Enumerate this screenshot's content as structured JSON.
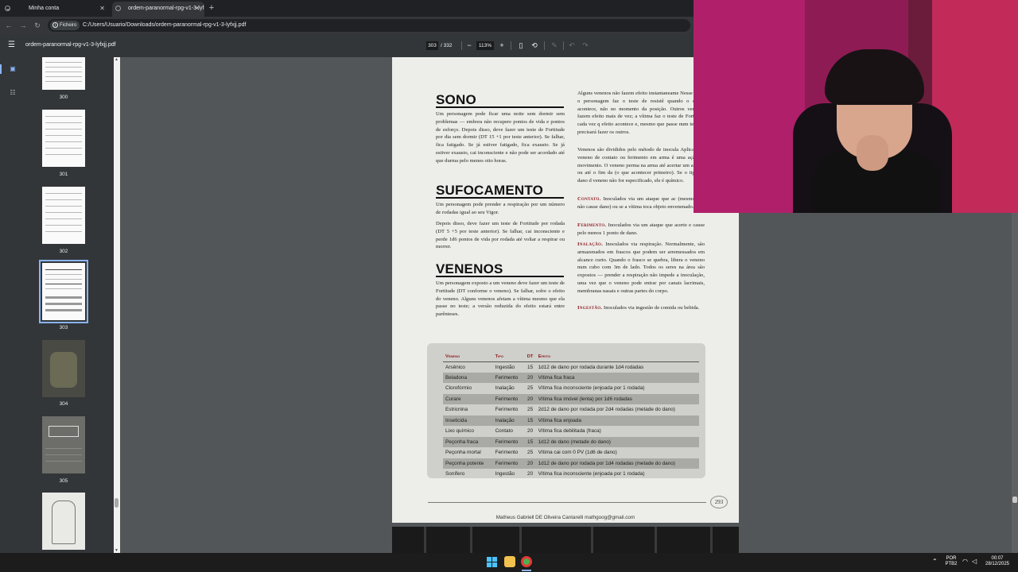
{
  "browser": {
    "tabs": [
      {
        "title": "Minha conta",
        "active": false
      },
      {
        "title": "ordem-paranormal-rpg-v1-3-lyf",
        "active": true
      }
    ],
    "address": {
      "chip": "Ficheiro",
      "url": "C:/Users/Usuario/Downloads/ordem-paranormal-rpg-v1-3-lyfxjj.pdf"
    }
  },
  "pdf_toolbar": {
    "doc_name": "ordem-paranormal-rpg-v1-3-lyfxjj.pdf",
    "current_page": "303",
    "page_total": "/ 332",
    "zoom": "113%"
  },
  "sidebar": {
    "thumbnails": [
      {
        "page": "300"
      },
      {
        "page": "301"
      },
      {
        "page": "302"
      },
      {
        "page": "303",
        "selected": true
      },
      {
        "page": "304"
      },
      {
        "page": "305"
      },
      {
        "page": ""
      }
    ]
  },
  "page": {
    "sono": {
      "heading": "SONO",
      "text": "Um personagem pode ficar uma noite sem dormir sem problemas — embora não recupere pontos de vida e pontos de esforço. Depois disso, deve fazer um teste de Fortitude por dia sem dormir (DT 15 +1 por teste anterior). Se falhar, fica fatigado. Se já estiver fatigado, fica exausto. Se já estiver exausto, cai inconsciente e não pode ser acordado até que durma pelo menos oito horas."
    },
    "sufocamento": {
      "heading": "SUFOCAMENTO",
      "text1": "Um personagem pode prender a respiração por um número de rodadas igual ao seu Vigor.",
      "text2": "Depois disso, deve fazer um teste de Fortitude por rodada (DT 5 +5 por teste anterior). Se falhar, cai inconsciente e perde 1d6 pontos de vida por rodada até voltar a respirar ou morrer."
    },
    "venenos": {
      "heading": "VENENOS",
      "text": "Um personagem exposto a um veneno deve fazer um teste de Fortitude (DT conforme o veneno). Se falhar, sofre o efeito do veneno. Alguns venenos afetam a vítima mesmo que ela passe no teste; a versão reduzida do efeito estará entre parênteses."
    },
    "right": {
      "p1": "Alguns venenos não fazem efeito instantaneame Nesse caso, o personagem faz o teste de resistê quando o efeito acontece, não no momento da posição. Outros venenos fazem efeito mais de vez; a vítima faz o teste de Fortitude cada vez q efeito acontece e, mesmo que passe num teste, a precisará fazer os outros.",
      "p2": "Venenos são divididos pelo método de inocula Aplicar um veneno de contato ou ferimento em arma é uma ação de movimento. O veneno perma na arma até acertar um ataque ou até o fim da (o que acontecer primeiro). Se o tipo de dano d veneno não for especificado, ele é químico.",
      "contato_label": "Contato.",
      "contato_text": "Inoculados via um ataque que ac (mesmo que não cause dano) ou se a vítima toca objeto envenenado.",
      "ferimento_label": "Ferimento.",
      "ferimento_text": "Inoculados via um ataque que acerte e cause pelo menos 1 ponto de dano.",
      "inalacao_label": "Inalação.",
      "inalacao_text": "Inoculados via respiração. Normalmente, são armazenados em frascos que podem ser arremessados em alcance curto. Quando o frasco se quebra, libera o veneno num cubo com 3m de lado. Todos os seres na área são expostos — prender a respiração não impede a inoculação, uma vez que o veneno pode entrar por canais lacrimais, membranas nasais e outras partes do corpo.",
      "ingestao_label": "Ingestão.",
      "ingestao_text": "Inoculados via ingestão de comida ou bebida."
    },
    "table": {
      "headers": [
        "Veneno",
        "Tipo",
        "DT",
        "Efeito"
      ],
      "rows": [
        [
          "Arsênico",
          "Ingestão",
          "15",
          "1d12 de dano por rodada durante 1d4 rodadas"
        ],
        [
          "Beladona",
          "Ferimento",
          "20",
          "Vítima fica fraca"
        ],
        [
          "Clorofórmio",
          "Inalação",
          "25",
          "Vítima fica inconsciente (enjoada por 1 rodada)"
        ],
        [
          "Curare",
          "Ferimento",
          "20",
          "Vítima fica imóvel (lenta) por 1d6 rodadas"
        ],
        [
          "Estricnina",
          "Ferimento",
          "25",
          "2d12 de dano por rodada por 2d4 rodadas (metade do dano)"
        ],
        [
          "Inseticida",
          "Inalação",
          "15",
          "Vítima fica enjoada"
        ],
        [
          "Lixo químico",
          "Contato",
          "20",
          "Vítima fica debilitada (fraca)"
        ],
        [
          "Peçonha fraca",
          "Ferimento",
          "15",
          "1d12 de dano (metade do dano)"
        ],
        [
          "Peçonha mortal",
          "Ferimento",
          "25",
          "Vítima cai com 0 PV (1d6 de dano)"
        ],
        [
          "Peçonha potente",
          "Ferimento",
          "20",
          "1d12 de dano por rodada por 1d4 rodadas (metade do dano)"
        ],
        [
          "Sonífero",
          "Ingestão",
          "20",
          "Vítima fica inconsciente (enjoada por 1 rodada)"
        ]
      ]
    },
    "page_number": "293",
    "footer": "Matheus Gabriell DE Oliveira Cantarelli mathgoog@gmail.com"
  },
  "taskbar": {
    "lang_top": "POR",
    "lang_bottom": "PTB2",
    "time": "00:07",
    "date": "28/12/2025"
  },
  "colors": {
    "accent": "#8ab4f8",
    "section_red": "#8b1a1a",
    "viewer_bg": "#525659",
    "toolbar_bg": "#323639"
  }
}
